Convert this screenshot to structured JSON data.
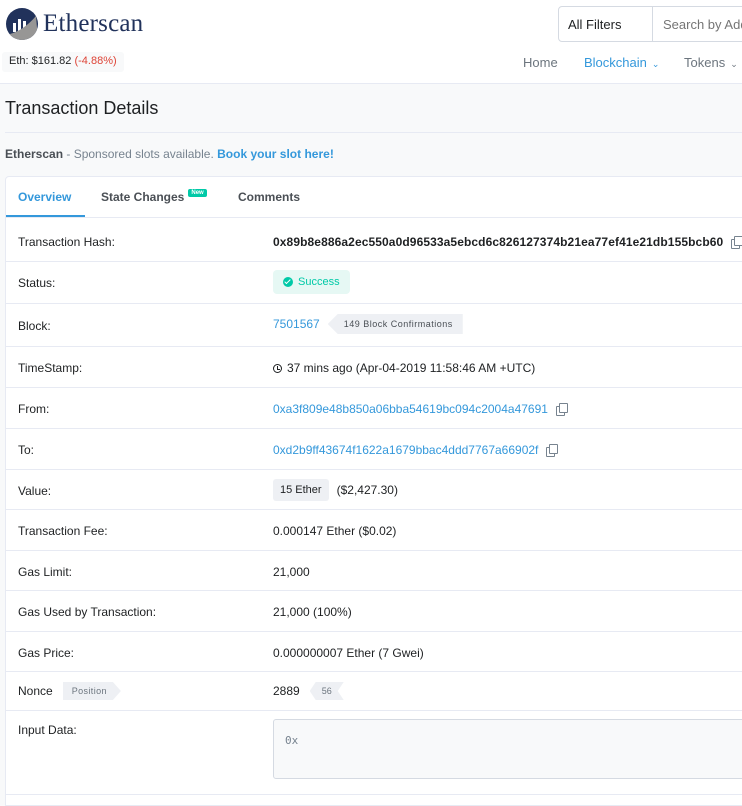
{
  "header": {
    "logo_text": "Etherscan",
    "eth_label": "Eth: $161.82",
    "eth_change": "(-4.88%)",
    "filter_label": "All Filters",
    "search_placeholder": "Search by Address / Txn Hash / Block / Token / Ens",
    "nav": [
      "Home",
      "Blockchain",
      "Tokens"
    ]
  },
  "page": {
    "title": "Transaction Details",
    "sponsor_brand": "Etherscan",
    "sponsor_text": " - Sponsored slots available. ",
    "sponsor_link": "Book your slot here!"
  },
  "tabs": {
    "overview": "Overview",
    "state_changes": "State Changes",
    "new_badge": "New",
    "comments": "Comments"
  },
  "details": {
    "hash_label": "Transaction Hash:",
    "hash": "0x89b8e886a2ec550a0d96533a5ebcd6c826127374b21ea77ef41e21db155bcb60",
    "status_label": "Status:",
    "status": "Success",
    "block_label": "Block:",
    "block": "7501567",
    "confirmations": "149 Block Confirmations",
    "timestamp_label": "TimeStamp:",
    "timestamp": "37 mins ago (Apr-04-2019 11:58:46 AM +UTC)",
    "from_label": "From:",
    "from": "0xa3f809e48b850a06bba54619bc094c2004a47691",
    "to_label": "To:",
    "to": "0xd2b9ff43674f1622a1679bbac4ddd7767a66902f",
    "value_label": "Value:",
    "value_eth": "15 Ether",
    "value_usd": "($2,427.30)",
    "fee_label": "Transaction Fee:",
    "fee": "0.000147 Ether ($0.02)",
    "gas_limit_label": "Gas Limit:",
    "gas_limit": "21,000",
    "gas_used_label": "Gas Used by Transaction:",
    "gas_used": "21,000 (100%)",
    "gas_price_label": "Gas Price:",
    "gas_price": "0.000000007 Ether (7 Gwei)",
    "nonce_label": "Nonce",
    "position_label": "Position",
    "nonce": "2889",
    "position": "56",
    "input_label": "Input Data:",
    "input": "0x"
  }
}
